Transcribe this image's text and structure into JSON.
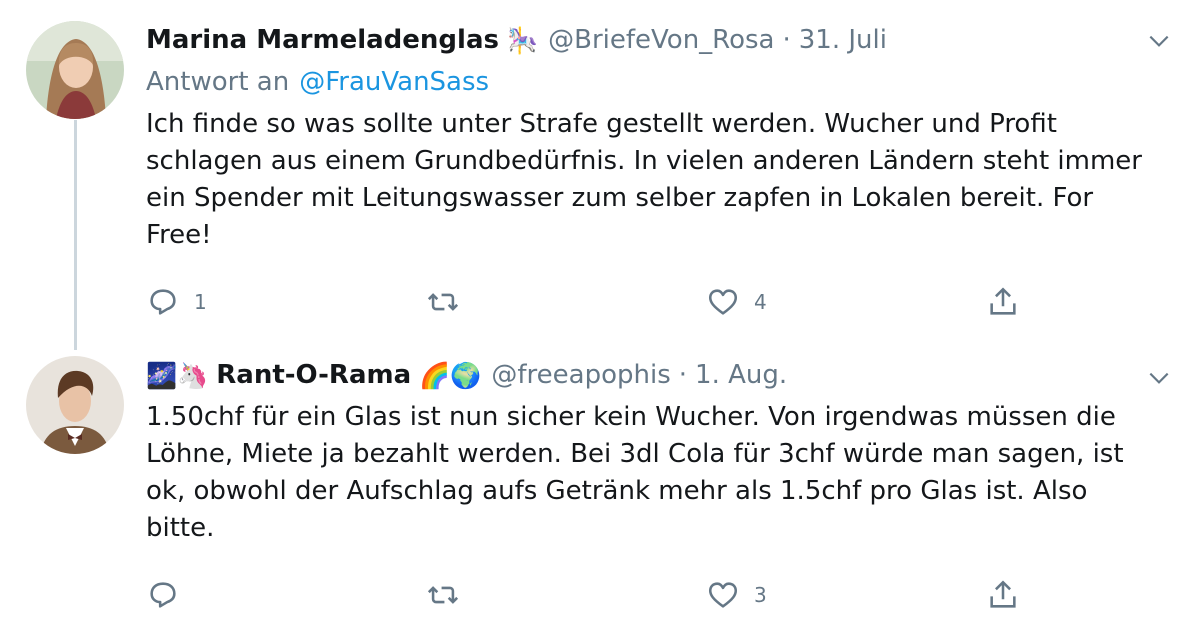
{
  "tweets": [
    {
      "author_name": "Marina Marmeladenglas",
      "author_emoji": "🎠",
      "handle": "@BriefeVon_Rosa",
      "separator": "·",
      "date": "31. Juli",
      "reply_label": "Antwort an",
      "reply_mention": "@FrauVanSass",
      "text_lines": [
        "Ich finde so was sollte unter Strafe gestellt werden. Wucher und Profit",
        "schlagen aus einem Grundbedürfnis. In vielen anderen Ländern steht immer",
        "ein Spender mit Leitungswasser zum selber zapfen in Lokalen bereit. For",
        "Free!"
      ],
      "reply_count": "1",
      "retweet_count": "",
      "like_count": "4",
      "icons": [
        "avatar",
        "reply-icon",
        "retweet-icon",
        "like-icon",
        "share-icon",
        "chevron-down-icon"
      ]
    },
    {
      "author_emoji_prefix": "🌌🦄",
      "author_name": "Rant-O-Rama",
      "author_emoji": "🌈🌍",
      "handle": "@freeapophis",
      "separator": "·",
      "date": "1. Aug.",
      "text_lines": [
        "1.50chf für ein Glas ist nun sicher kein Wucher. Von irgendwas müssen die",
        "Löhne, Miete ja bezahlt werden. Bei 3dl Cola für 3chf würde man sagen, ist",
        "ok, obwohl der Aufschlag aufs Getränk mehr als 1.5chf pro Glas ist. Also",
        "bitte."
      ],
      "reply_count": "",
      "retweet_count": "",
      "like_count": "3"
    }
  ],
  "colors": {
    "text": "#14171a",
    "secondary": "#657786",
    "link": "#1b95e0",
    "thread_line": "#ccd6dd"
  }
}
